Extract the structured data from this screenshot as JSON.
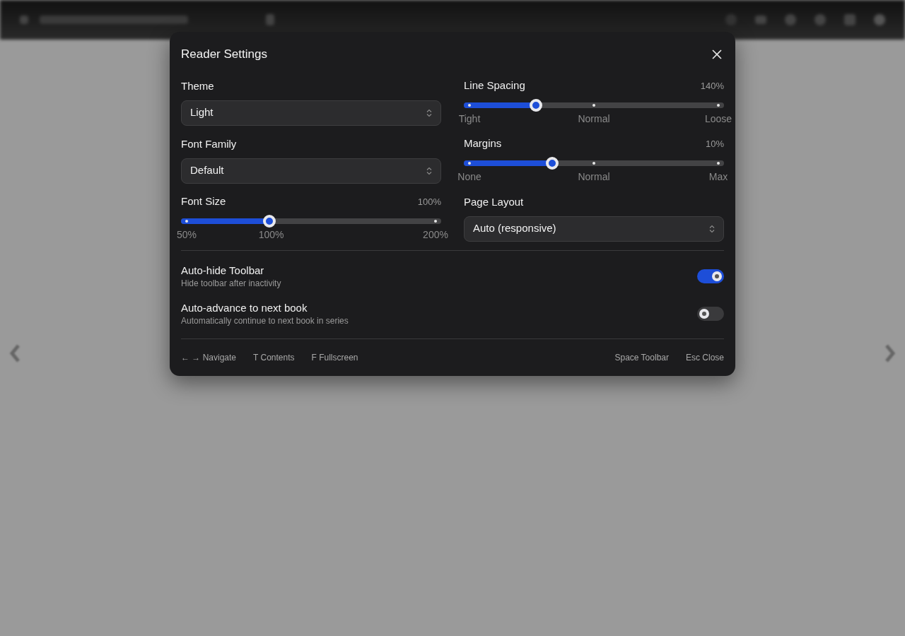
{
  "dialog": {
    "title": "Reader Settings"
  },
  "left": [
    {
      "kind": "select",
      "label": "Theme",
      "value": "Light"
    },
    {
      "kind": "select",
      "label": "Font Family",
      "value": "Default"
    },
    {
      "kind": "slider",
      "label": "Font Size",
      "reading": "100%",
      "level": 0.34,
      "marks": [
        "50%",
        "100%",
        "200%"
      ]
    }
  ],
  "right": [
    {
      "kind": "stepslider",
      "label": "Line Spacing",
      "reading": "140%",
      "level": 0.277,
      "marks": [
        "Tight",
        "Normal",
        "Loose"
      ]
    },
    {
      "kind": "stepslider",
      "label": "Margins",
      "reading": "10%",
      "level": 0.34,
      "marks": [
        "None",
        "Normal",
        "Max"
      ]
    },
    {
      "kind": "select",
      "label": "Page Layout",
      "value": "Auto (responsive)"
    }
  ],
  "toggles": [
    {
      "title": "Auto-hide Toolbar",
      "description": "Hide toolbar after inactivity",
      "on": true
    },
    {
      "title": "Auto-advance to next book",
      "description": "Automatically continue to next book in series",
      "on": false
    }
  ],
  "shortcuts_left": [
    "← → Navigate",
    "T Contents",
    "F Fullscreen"
  ],
  "shortcuts_right": [
    "Space Toolbar",
    "Esc Close"
  ]
}
